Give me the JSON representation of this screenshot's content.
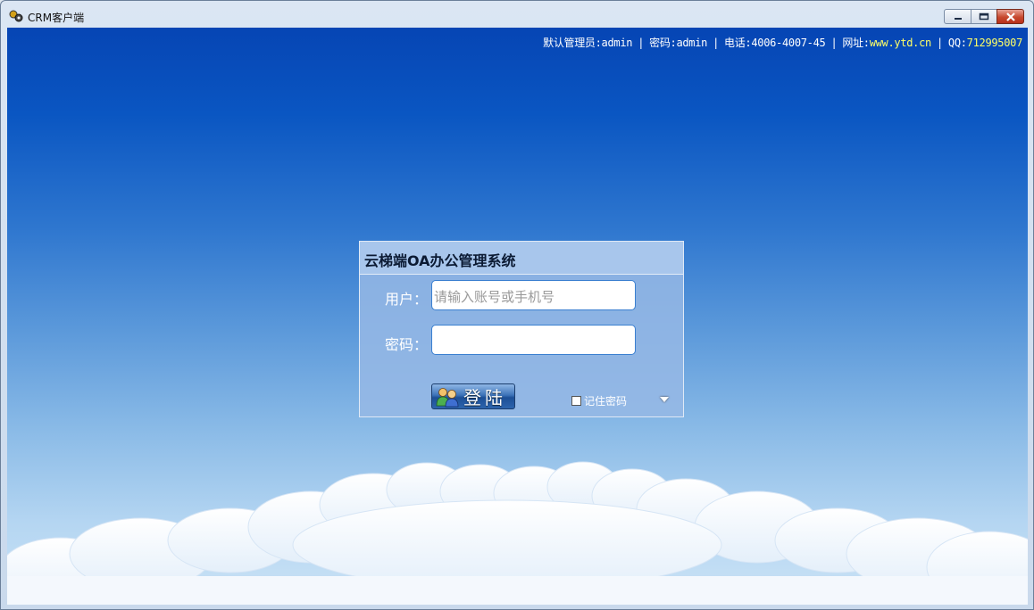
{
  "window": {
    "title": "CRM客户端",
    "icon": "crm-app-icon",
    "controls": [
      "minimize-icon",
      "maximize-icon",
      "close-icon"
    ]
  },
  "info_bar": {
    "admin_label": "默认管理员:admin",
    "password_label": "密码:admin",
    "phone_label": "电话:4006-4007-45",
    "website_prefix": "网址:",
    "website": "www.ytd.cn",
    "qq_prefix": "QQ:",
    "qq": "712995007",
    "separator": "|"
  },
  "login": {
    "title": "云梯端OA办公管理系统",
    "user_label": "用户：",
    "user_placeholder": "请输入账号或手机号",
    "user_value": "",
    "password_label": "密码：",
    "password_value": "",
    "login_button": "登陆",
    "login_icon": "users-icon",
    "remember_label": "记住密码",
    "remember_checked": false
  },
  "colors": {
    "sky_top": "#0645b4",
    "sky_bottom": "#cbe3f6",
    "highlight": "#ffff66",
    "panel": "#96b8e5"
  }
}
